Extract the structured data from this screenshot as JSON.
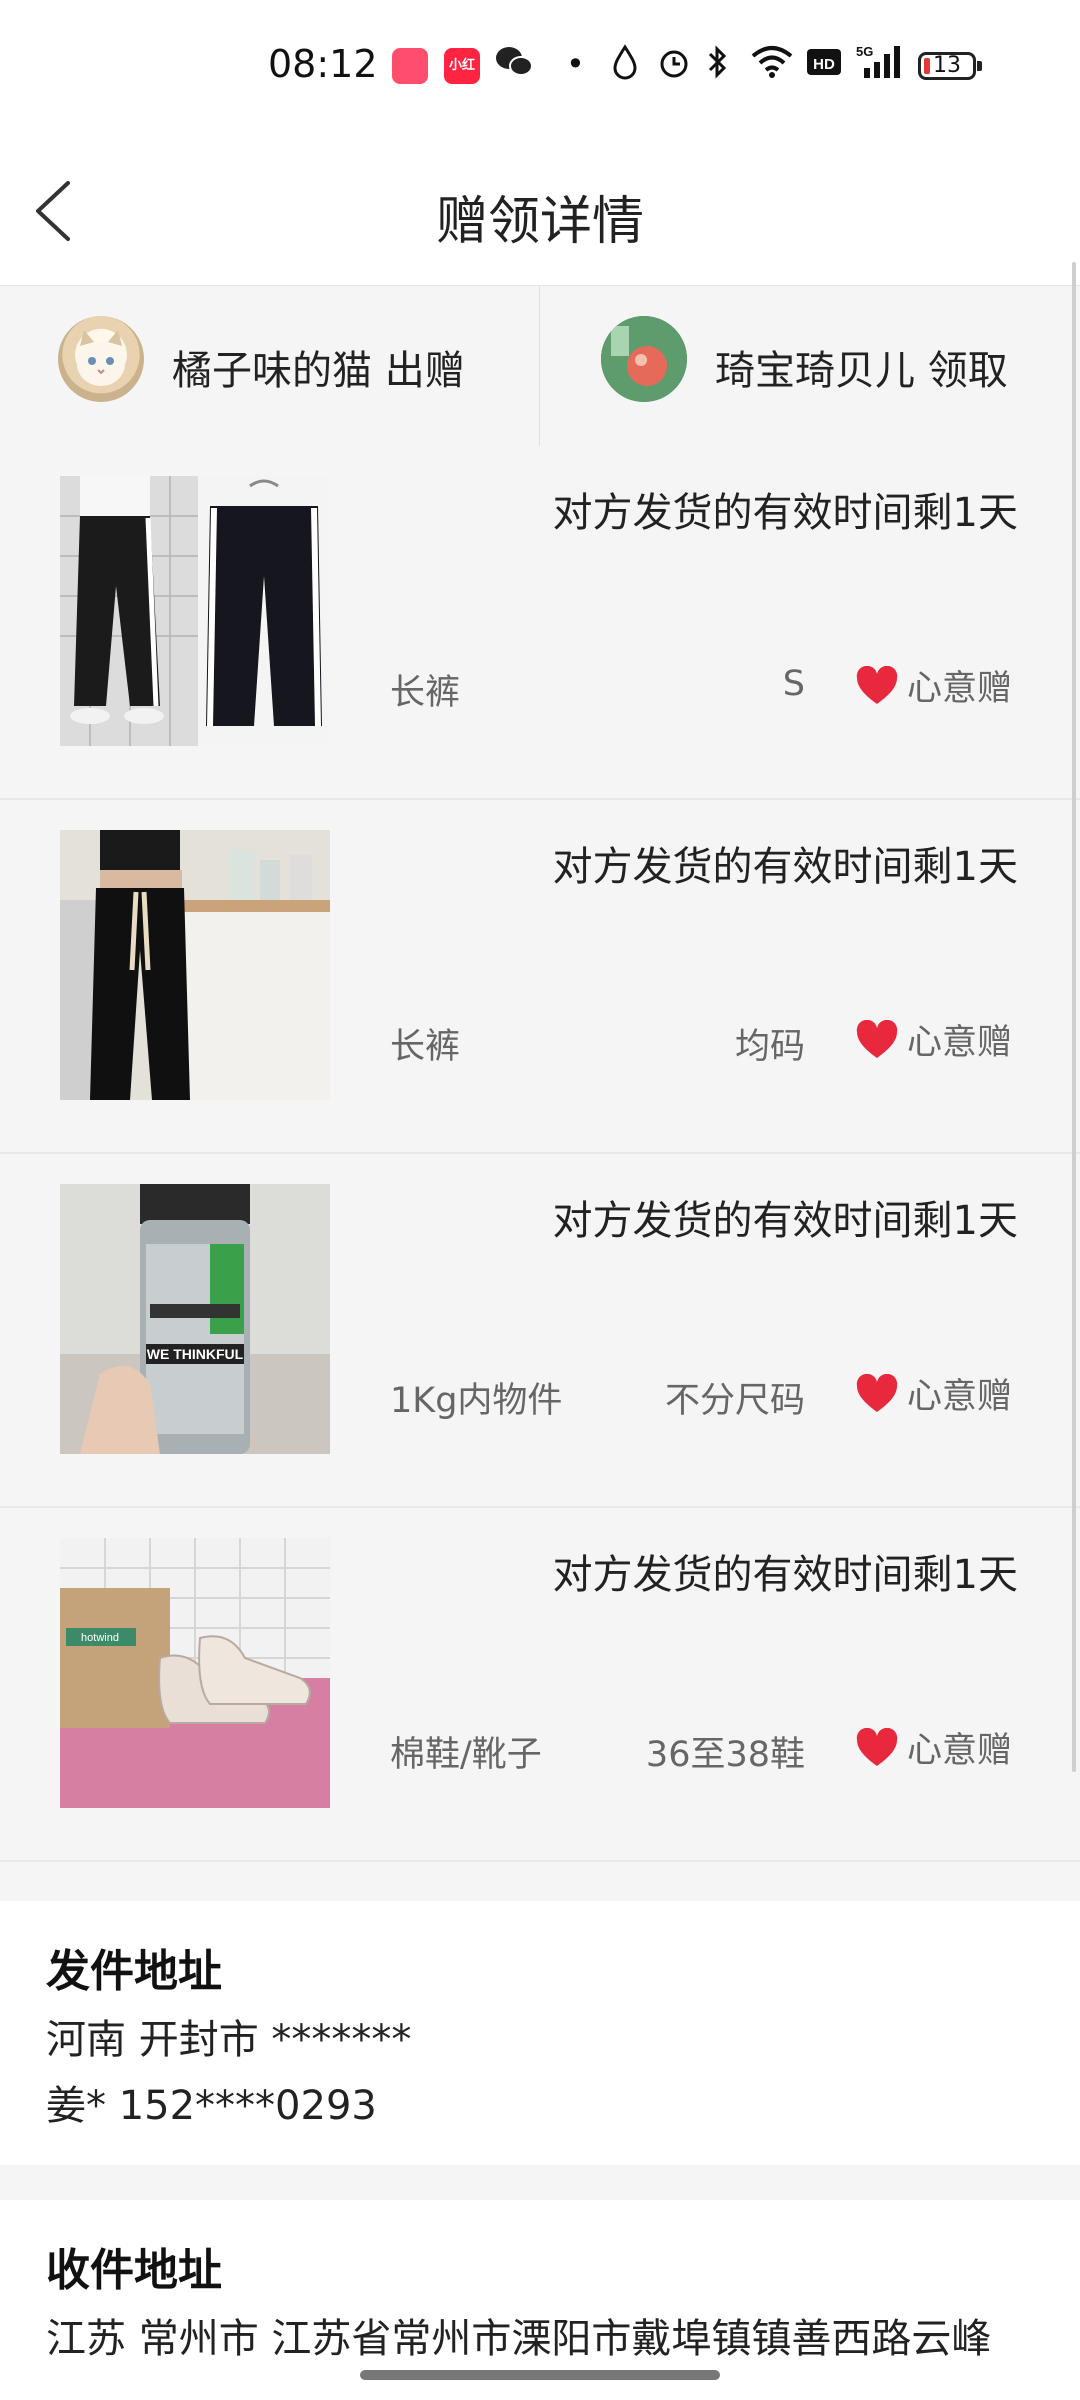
{
  "status_bar": {
    "time": "08:12",
    "app_icons": [
      {
        "name": "live-app-icon",
        "color": "#ff4d6d",
        "label": ""
      },
      {
        "name": "xiaohongshu-icon",
        "color": "#ff2442",
        "label": "小红书"
      },
      {
        "name": "wechat-icon",
        "color": "#222222",
        "label": ""
      }
    ],
    "battery": "13"
  },
  "header": {
    "title": "赠领详情"
  },
  "parties": {
    "giver": {
      "name": "橘子味的猫 出赠"
    },
    "receiver": {
      "name": "琦宝琦贝儿 领取"
    }
  },
  "items": [
    {
      "notice": "对方发货的有效时间剩1天",
      "category": "长裤",
      "size": "S",
      "gift_label": "心意赠",
      "thumb": "pants-white-stripe"
    },
    {
      "notice": "对方发货的有效时间剩1天",
      "category": "长裤",
      "size": "均码",
      "gift_label": "心意赠",
      "thumb": "pants-drawstring"
    },
    {
      "notice": "对方发货的有效时间剩1天",
      "category": "1Kg内物件",
      "size": "不分尺码",
      "gift_label": "心意赠",
      "thumb": "water-bottle"
    },
    {
      "notice": "对方发货的有效时间剩1天",
      "category": "棉鞋/靴子",
      "size": "36至38鞋",
      "gift_label": "心意赠",
      "thumb": "sneakers"
    }
  ],
  "send_address": {
    "title": "发件地址",
    "region": "河南 开封市 *******",
    "contact": "姜* 152****0293"
  },
  "receive_address": {
    "title": "收件地址",
    "region": "江苏 常州市 江苏省常州市溧阳市戴埠镇镇善西路云峰"
  },
  "colors": {
    "heart": "#e8283c",
    "background": "#f5f5f5"
  }
}
